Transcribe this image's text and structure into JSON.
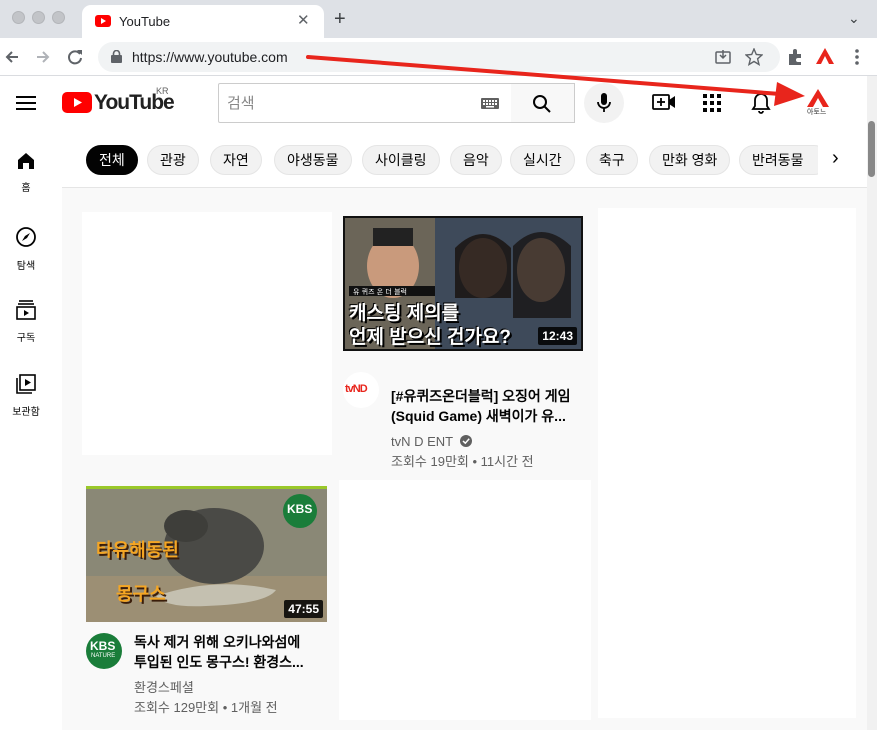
{
  "browser": {
    "tab_title": "YouTube",
    "tab_close": "✕",
    "new_tab": "+",
    "tab_menu": "⌄",
    "url": "https://www.youtube.com",
    "icons": [
      "back-icon",
      "forward-icon",
      "reload-icon",
      "lock-icon",
      "install-icon",
      "bookmark-star-icon",
      "extensions-icon",
      "ext-a-icon",
      "kebab-menu-icon"
    ]
  },
  "masthead": {
    "logo_text": "YouTube",
    "region": "KR",
    "search_placeholder": "검색",
    "avatar_label": "아토느"
  },
  "sidebar": [
    {
      "label": "홈",
      "icon": "home-icon"
    },
    {
      "label": "탐색",
      "icon": "compass-icon"
    },
    {
      "label": "구독",
      "icon": "subscriptions-icon"
    },
    {
      "label": "보관함",
      "icon": "library-icon"
    }
  ],
  "chips": [
    "전체",
    "관광",
    "자연",
    "야생동물",
    "사이클링",
    "음악",
    "실시간",
    "축구",
    "만화 영화",
    "반려동물"
  ],
  "chips_next": "›",
  "videos": [
    {
      "title_line1": "[#유퀴즈온더블럭] 오징어 게임",
      "title_line2": "(Squid Game) 새벽이가 유...",
      "channel": "tvN D ENT",
      "stats": "조회수 19만회 • 11시간 전",
      "duration": "12:43",
      "thumb_caption_1": "캐스팅 제의를",
      "thumb_caption_2": "언제 받으신 건가요?",
      "channel_avatar_text": "tvND"
    },
    {
      "title_line1": "독사 제거 위해 오키나와섬에",
      "title_line2": "투입된 인도 몽구스! 환경스...",
      "channel": "환경스페셜",
      "stats": "조회수 129만회 • 1개월 전",
      "duration": "47:55",
      "thumb_caption_1": "타유해동된",
      "thumb_caption_2": "몽구스",
      "channel_avatar_text": "KBS",
      "channel_avatar_sub": "NATURE"
    }
  ],
  "colors": {
    "youtube_red": "#ff0000",
    "annotation_arrow": "#e8251c",
    "kbs_green": "#1a7d3a"
  }
}
